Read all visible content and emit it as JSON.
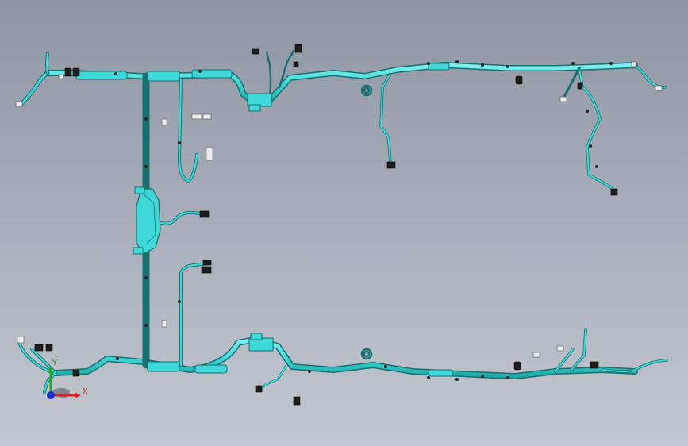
{
  "viewport": {
    "background_top": "#8e96a3",
    "background_bottom": "#c3c8d0"
  },
  "model": {
    "name": "wire-harness-assembly",
    "wire_color": "#3fd8d8",
    "wire_edge_color": "#1a6f6f",
    "connector_color": "#1c1c1c",
    "clip_color": "#e8e8e8"
  },
  "triad": {
    "x_label": "X",
    "y_label": "Y",
    "x_color": "#d42424",
    "y_color": "#22a822",
    "z_color": "#1f2fd0"
  }
}
